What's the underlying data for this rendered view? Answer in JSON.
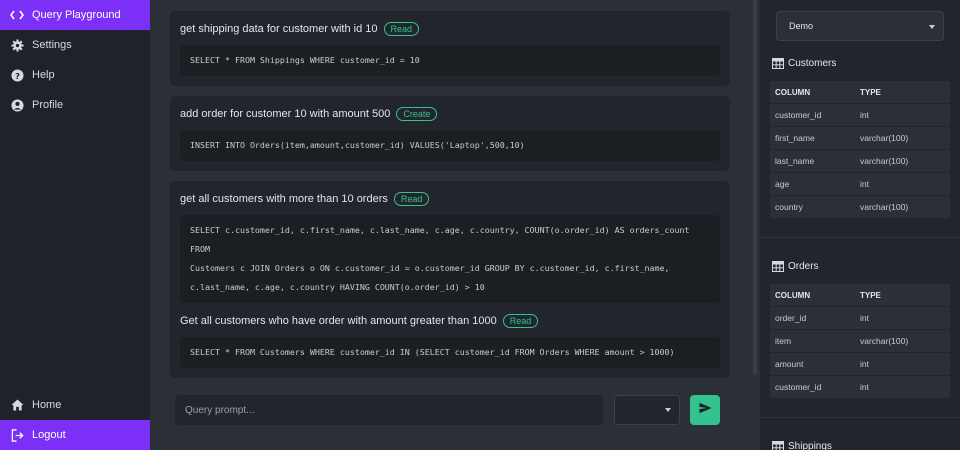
{
  "sidebar": {
    "items": [
      {
        "label": "Query Playground",
        "icon": "code-icon"
      },
      {
        "label": "Settings",
        "icon": "gear-icon"
      },
      {
        "label": "Help",
        "icon": "help-icon"
      },
      {
        "label": "Profile",
        "icon": "user-icon"
      }
    ],
    "bottom": [
      {
        "label": "Home",
        "icon": "home-icon"
      },
      {
        "label": "Logout",
        "icon": "logout-icon"
      }
    ]
  },
  "queries": [
    {
      "prompt": "get shipping data for customer with id 10",
      "badge": "Read",
      "sql": [
        "SELECT * FROM Shippings WHERE customer_id = 10"
      ]
    },
    {
      "prompt": "add order for customer 10 with amount 500",
      "badge": "Create",
      "sql": [
        "INSERT INTO Orders(item,amount,customer_id) VALUES('Laptop',500,10)"
      ]
    },
    {
      "prompt": "get all customers with more than 10 orders",
      "badge": "Read",
      "sql": [
        "SELECT c.customer_id, c.first_name, c.last_name, c.age, c.country, COUNT(o.order_id) AS orders_count FROM",
        "Customers c JOIN Orders o ON c.customer_id = o.customer_id GROUP BY c.customer_id, c.first_name,",
        "c.last_name, c.age, c.country HAVING COUNT(o.order_id) > 10"
      ]
    },
    {
      "prompt": "Get all customers who have order with amount greater than 1000",
      "badge": "Read",
      "sql": [
        "SELECT * FROM Customers WHERE customer_id IN (SELECT customer_id FROM Orders WHERE amount > 1000)"
      ]
    }
  ],
  "prompt": {
    "placeholder": "Query prompt...",
    "select_value": ""
  },
  "database": {
    "selected": "Demo"
  },
  "tables": [
    {
      "name": "Customers",
      "headers": [
        "COLUMN",
        "TYPE"
      ],
      "rows": [
        [
          "customer_id",
          "int"
        ],
        [
          "first_name",
          "varchar(100)"
        ],
        [
          "last_name",
          "varchar(100)"
        ],
        [
          "age",
          "int"
        ],
        [
          "country",
          "varchar(100)"
        ]
      ]
    },
    {
      "name": "Orders",
      "headers": [
        "COLUMN",
        "TYPE"
      ],
      "rows": [
        [
          "order_id",
          "int"
        ],
        [
          "item",
          "varchar(100)"
        ],
        [
          "amount",
          "int"
        ],
        [
          "customer_id",
          "int"
        ]
      ]
    },
    {
      "name": "Shippings",
      "headers": [],
      "rows": []
    }
  ],
  "colors": {
    "accent": "#7b2ff7",
    "success": "#34c38f"
  }
}
